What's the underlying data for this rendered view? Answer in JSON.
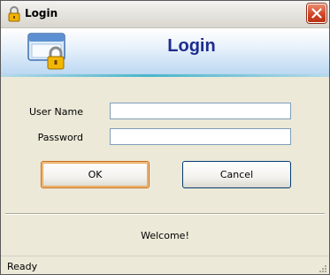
{
  "window": {
    "title": "Login",
    "close_label": "✕"
  },
  "banner": {
    "title": "Login",
    "title_color": "#1d2c8e"
  },
  "form": {
    "username_label": "User Name",
    "username_value": "",
    "password_label": "Password",
    "password_value": ""
  },
  "buttons": {
    "ok_label": "OK",
    "cancel_label": "Cancel"
  },
  "message": "Welcome!",
  "status": {
    "text": "Ready"
  },
  "icons": {
    "title": "lock-icon",
    "banner": "window-lock-icon",
    "close": "close-icon",
    "grip": "resize-grip-icon"
  }
}
